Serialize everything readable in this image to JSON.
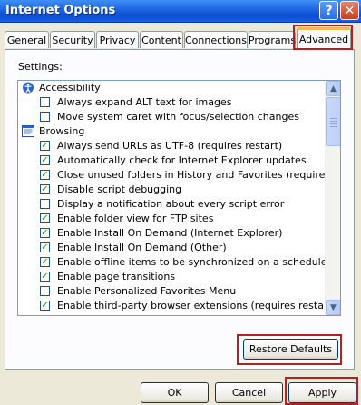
{
  "window": {
    "title": "Internet Options",
    "help_glyph": "?",
    "close_glyph": "✕"
  },
  "tabs": [
    {
      "label": "General"
    },
    {
      "label": "Security"
    },
    {
      "label": "Privacy"
    },
    {
      "label": "Content"
    },
    {
      "label": "Connections"
    },
    {
      "label": "Programs"
    },
    {
      "label": "Advanced",
      "active": true
    }
  ],
  "panel": {
    "settings_label": "Settings:"
  },
  "settings": [
    {
      "type": "category",
      "label": "Accessibility",
      "icon": "accessibility-icon"
    },
    {
      "type": "checkbox",
      "label": "Always expand ALT text for images",
      "checked": false
    },
    {
      "type": "checkbox",
      "label": "Move system caret with focus/selection changes",
      "checked": false
    },
    {
      "type": "category",
      "label": "Browsing",
      "icon": "browsing-icon"
    },
    {
      "type": "checkbox",
      "label": "Always send URLs as UTF-8 (requires restart)",
      "checked": true
    },
    {
      "type": "checkbox",
      "label": "Automatically check for Internet Explorer updates",
      "checked": true
    },
    {
      "type": "checkbox",
      "label": "Close unused folders in History and Favorites (requires restart)",
      "checked": true
    },
    {
      "type": "checkbox",
      "label": "Disable script debugging",
      "checked": true
    },
    {
      "type": "checkbox",
      "label": "Display a notification about every script error",
      "checked": false
    },
    {
      "type": "checkbox",
      "label": "Enable folder view for FTP sites",
      "checked": true
    },
    {
      "type": "checkbox",
      "label": "Enable Install On Demand (Internet Explorer)",
      "checked": true
    },
    {
      "type": "checkbox",
      "label": "Enable Install On Demand (Other)",
      "checked": true
    },
    {
      "type": "checkbox",
      "label": "Enable offline items to be synchronized on a schedule",
      "checked": true
    },
    {
      "type": "checkbox",
      "label": "Enable page transitions",
      "checked": true
    },
    {
      "type": "checkbox",
      "label": "Enable Personalized Favorites Menu",
      "checked": false
    },
    {
      "type": "checkbox",
      "label": "Enable third-party browser extensions (requires restart)",
      "checked": true
    }
  ],
  "buttons": {
    "restore_defaults": "Restore Defaults",
    "ok": "OK",
    "cancel": "Cancel",
    "apply": "Apply"
  },
  "colors": {
    "titlebar": "#0a4fd6",
    "highlight_box": "#b22222",
    "check": "#21a121"
  }
}
